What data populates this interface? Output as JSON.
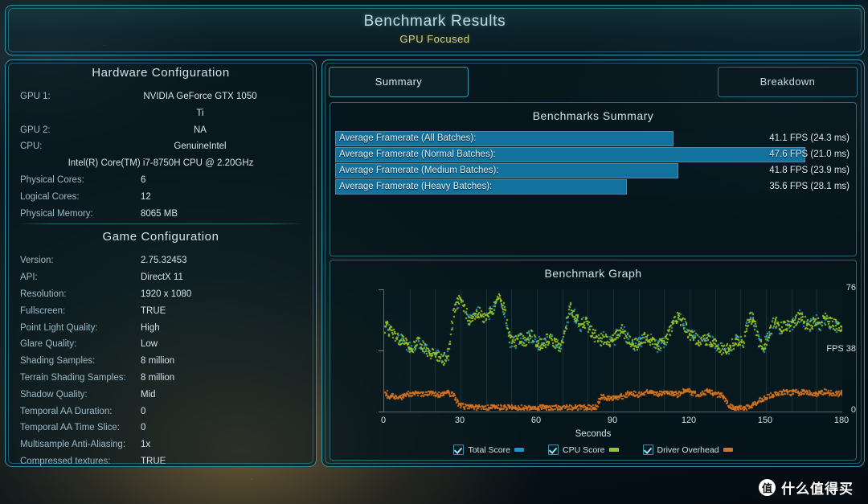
{
  "header": {
    "title": "Benchmark Results",
    "subtitle": "GPU Focused"
  },
  "tabs": [
    {
      "label": "Summary",
      "active": true
    },
    {
      "label": "Breakdown",
      "active": false
    }
  ],
  "hardware": {
    "title": "Hardware Configuration",
    "rows": [
      {
        "key": "GPU 1:",
        "value": "NVIDIA GeForce GTX 1050 Ti"
      },
      {
        "key": "GPU 2:",
        "value": "NA"
      },
      {
        "key": "CPU:",
        "value": "GenuineIntel"
      },
      {
        "key": "",
        "value": "Intel(R) Core(TM) i7-8750H CPU @ 2.20GHz"
      },
      {
        "key": "Physical Cores:",
        "value": "6"
      },
      {
        "key": "Logical Cores:",
        "value": "12"
      },
      {
        "key": "Physical Memory:",
        "value": "8065  MB"
      }
    ]
  },
  "game": {
    "title": "Game Configuration",
    "rows": [
      {
        "key": "Version:",
        "value": "2.75.32453"
      },
      {
        "key": "API:",
        "value": "DirectX 11"
      },
      {
        "key": "Resolution:",
        "value": "1920 x 1080"
      },
      {
        "key": "Fullscreen:",
        "value": "TRUE"
      },
      {
        "key": "Point Light Quality:",
        "value": "High"
      },
      {
        "key": "Glare Quality:",
        "value": "Low"
      },
      {
        "key": "Shading Samples:",
        "value": "8 million"
      },
      {
        "key": "Terrain Shading Samples:",
        "value": "8 million"
      },
      {
        "key": "Shadow Quality:",
        "value": "Mid"
      },
      {
        "key": "Temporal AA Duration:",
        "value": "0"
      },
      {
        "key": "Temporal AA Time Slice:",
        "value": "0"
      },
      {
        "key": "Multisample Anti-Aliasing:",
        "value": "1x"
      },
      {
        "key": "Compressed textures:",
        "value": "TRUE"
      }
    ]
  },
  "summary": {
    "title": "Benchmarks Summary",
    "bars": [
      {
        "label": "Average Framerate (All Batches):",
        "value": "41.1 FPS (24.3 ms)",
        "fps": 41.1,
        "ms": 24.3,
        "pct": 72
      },
      {
        "label": "Average Framerate (Normal Batches):",
        "value": "47.6 FPS (21.0 ms)",
        "fps": 47.6,
        "ms": 21.0,
        "pct": 100
      },
      {
        "label": "Average Framerate (Medium Batches):",
        "value": "41.8 FPS (23.9 ms)",
        "fps": 41.8,
        "ms": 23.9,
        "pct": 73
      },
      {
        "label": "Average Framerate (Heavy Batches):",
        "value": "35.6 FPS (28.1 ms)",
        "fps": 35.6,
        "ms": 28.1,
        "pct": 62
      }
    ]
  },
  "graph": {
    "title": "Benchmark Graph",
    "legend": [
      {
        "label": "Total Score",
        "color": "#2196c4",
        "checked": true
      },
      {
        "label": "CPU Score",
        "color": "#9ac61e",
        "checked": true
      },
      {
        "label": "Driver Overhead",
        "color": "#d4721e",
        "checked": true
      }
    ]
  },
  "chart_data": {
    "type": "scatter",
    "title": "Benchmark Graph",
    "xlabel": "Seconds",
    "ylabel": "FPS",
    "xlim": [
      0,
      180
    ],
    "ylim": [
      0,
      76
    ],
    "xticks": [
      0,
      30,
      60,
      90,
      120,
      150,
      180
    ],
    "yticks": [
      0,
      38,
      76
    ],
    "ytick_labels": [
      "0",
      "FPS 38",
      "76"
    ],
    "grid": "vertical",
    "legend_position": "bottom",
    "series": [
      {
        "name": "Total Score",
        "color": "#2196c4",
        "note": "blue points interleaved with CPU Score in the upper band, roughly 30-70 FPS"
      },
      {
        "name": "CPU Score",
        "color": "#9ac61e",
        "note": "yellow-green points forming the dominant upper band, roughly 30-72 FPS",
        "samples": [
          [
            1,
            52
          ],
          [
            3,
            49
          ],
          [
            5,
            46
          ],
          [
            7,
            44
          ],
          [
            9,
            42
          ],
          [
            11,
            40
          ],
          [
            13,
            44
          ],
          [
            15,
            41
          ],
          [
            17,
            38
          ],
          [
            19,
            36
          ],
          [
            21,
            34
          ],
          [
            23,
            33
          ],
          [
            25,
            37
          ],
          [
            27,
            62
          ],
          [
            29,
            70
          ],
          [
            31,
            66
          ],
          [
            33,
            57
          ],
          [
            35,
            60
          ],
          [
            37,
            63
          ],
          [
            39,
            58
          ],
          [
            41,
            61
          ],
          [
            43,
            66
          ],
          [
            45,
            70
          ],
          [
            47,
            64
          ],
          [
            49,
            45
          ],
          [
            51,
            43
          ],
          [
            53,
            46
          ],
          [
            55,
            44
          ],
          [
            57,
            48
          ],
          [
            59,
            45
          ],
          [
            61,
            42
          ],
          [
            63,
            44
          ],
          [
            65,
            47
          ],
          [
            67,
            43
          ],
          [
            69,
            40
          ],
          [
            71,
            52
          ],
          [
            73,
            66
          ],
          [
            75,
            58
          ],
          [
            77,
            54
          ],
          [
            79,
            56
          ],
          [
            81,
            50
          ],
          [
            83,
            47
          ],
          [
            85,
            45
          ],
          [
            87,
            46
          ],
          [
            89,
            43
          ],
          [
            91,
            48
          ],
          [
            93,
            52
          ],
          [
            95,
            47
          ],
          [
            97,
            44
          ],
          [
            99,
            42
          ],
          [
            101,
            45
          ],
          [
            103,
            47
          ],
          [
            105,
            44
          ],
          [
            107,
            41
          ],
          [
            109,
            43
          ],
          [
            111,
            46
          ],
          [
            113,
            55
          ],
          [
            115,
            60
          ],
          [
            117,
            57
          ],
          [
            119,
            50
          ],
          [
            121,
            47
          ],
          [
            123,
            45
          ],
          [
            125,
            44
          ],
          [
            127,
            46
          ],
          [
            129,
            43
          ],
          [
            131,
            41
          ],
          [
            133,
            38
          ],
          [
            135,
            40
          ],
          [
            137,
            43
          ],
          [
            139,
            46
          ],
          [
            141,
            44
          ],
          [
            143,
            60
          ],
          [
            145,
            57
          ],
          [
            147,
            44
          ],
          [
            149,
            42
          ],
          [
            151,
            47
          ],
          [
            153,
            58
          ],
          [
            155,
            52
          ],
          [
            157,
            55
          ],
          [
            159,
            53
          ],
          [
            161,
            57
          ],
          [
            163,
            60
          ],
          [
            165,
            56
          ],
          [
            167,
            54
          ],
          [
            169,
            57
          ],
          [
            171,
            55
          ],
          [
            173,
            58
          ],
          [
            175,
            56
          ],
          [
            177,
            54
          ],
          [
            179,
            53
          ]
        ]
      },
      {
        "name": "Driver Overhead",
        "color": "#d4721e",
        "note": "orange points forming the lower band, roughly 2-15 FPS",
        "samples": [
          [
            1,
            9
          ],
          [
            3,
            11
          ],
          [
            5,
            8
          ],
          [
            7,
            10
          ],
          [
            9,
            12
          ],
          [
            11,
            11
          ],
          [
            13,
            12
          ],
          [
            15,
            11
          ],
          [
            17,
            12
          ],
          [
            19,
            12
          ],
          [
            21,
            11
          ],
          [
            23,
            12
          ],
          [
            25,
            12
          ],
          [
            27,
            11
          ],
          [
            29,
            5
          ],
          [
            31,
            4
          ],
          [
            33,
            3
          ],
          [
            35,
            3
          ],
          [
            37,
            3
          ],
          [
            39,
            3
          ],
          [
            41,
            3
          ],
          [
            43,
            3
          ],
          [
            45,
            3
          ],
          [
            47,
            3
          ],
          [
            49,
            3
          ],
          [
            51,
            3
          ],
          [
            53,
            3
          ],
          [
            55,
            3
          ],
          [
            57,
            3
          ],
          [
            59,
            3
          ],
          [
            61,
            3
          ],
          [
            63,
            3
          ],
          [
            65,
            3
          ],
          [
            67,
            3
          ],
          [
            69,
            3
          ],
          [
            71,
            3
          ],
          [
            73,
            3
          ],
          [
            75,
            3
          ],
          [
            77,
            3
          ],
          [
            79,
            3
          ],
          [
            81,
            3
          ],
          [
            83,
            3
          ],
          [
            85,
            10
          ],
          [
            87,
            9
          ],
          [
            89,
            8
          ],
          [
            91,
            9
          ],
          [
            93,
            10
          ],
          [
            95,
            11
          ],
          [
            97,
            12
          ],
          [
            99,
            11
          ],
          [
            101,
            12
          ],
          [
            103,
            13
          ],
          [
            105,
            12
          ],
          [
            107,
            11
          ],
          [
            109,
            12
          ],
          [
            111,
            13
          ],
          [
            113,
            12
          ],
          [
            115,
            11
          ],
          [
            117,
            13
          ],
          [
            119,
            14
          ],
          [
            121,
            12
          ],
          [
            123,
            11
          ],
          [
            125,
            12
          ],
          [
            127,
            13
          ],
          [
            129,
            12
          ],
          [
            131,
            11
          ],
          [
            133,
            10
          ],
          [
            135,
            4
          ],
          [
            137,
            3
          ],
          [
            139,
            3
          ],
          [
            141,
            3
          ],
          [
            143,
            3
          ],
          [
            145,
            5
          ],
          [
            147,
            7
          ],
          [
            149,
            9
          ],
          [
            151,
            10
          ],
          [
            153,
            11
          ],
          [
            155,
            12
          ],
          [
            157,
            13
          ],
          [
            159,
            12
          ],
          [
            161,
            13
          ],
          [
            163,
            12
          ],
          [
            165,
            13
          ],
          [
            167,
            12
          ],
          [
            169,
            11
          ],
          [
            171,
            12
          ],
          [
            173,
            13
          ],
          [
            175,
            12
          ],
          [
            177,
            11
          ],
          [
            179,
            12
          ]
        ]
      }
    ]
  },
  "watermark": {
    "logo": "值",
    "text": "什么值得买"
  }
}
